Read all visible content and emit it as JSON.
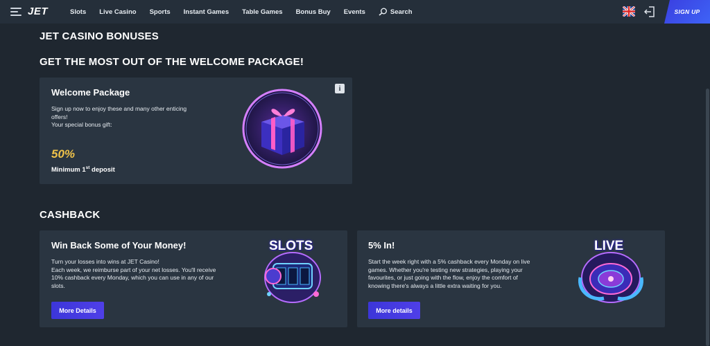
{
  "header": {
    "logo": "JET",
    "nav": [
      "Slots",
      "Live Casino",
      "Sports",
      "Instant Games",
      "Table Games",
      "Bonus Buy",
      "Events"
    ],
    "search_label": "Search",
    "signup_label": "SIGN UP",
    "language_flag": "uk-flag",
    "icons": [
      "hamburger-menu-icon",
      "search-icon",
      "login-icon"
    ]
  },
  "page": {
    "title": "JET CASINO BONUSES",
    "subtitle": "GET THE MOST OUT OF THE WELCOME PACKAGE!",
    "cashback_heading": "CASHBACK"
  },
  "welcome": {
    "title": "Welcome Package",
    "text_line1": "Sign up now to enjoy these and many other enticing",
    "text_line2": "offers!",
    "text_line3": "Your special bonus gift:",
    "percent": "50%",
    "deposit_prefix": "Minimum 1",
    "deposit_sup": "st",
    "deposit_suffix": " deposit",
    "info_label": "i"
  },
  "cashback": [
    {
      "title": "Win Back Some of Your Money!",
      "lines": [
        "Turn your losses into wins at JET Casino!",
        "Each week, we reimburse part of your net losses. You'll receive",
        "10% cashback every Monday, which you can use in any of our",
        "slots."
      ],
      "button": "More Details",
      "badge": "SLOTS"
    },
    {
      "title": "5% In!",
      "lines": [
        "Start the week right with a 5% cashback every Monday on live",
        "games. Whether you're testing new strategies, playing your",
        "favourites, or just going with the flow, enjoy the comfort of",
        "knowing there's always a little extra waiting for you."
      ],
      "button": "More details",
      "badge": "LIVE"
    }
  ],
  "colors": {
    "page_bg": "#1f2730",
    "header_bg": "#252f3a",
    "card_bg": "#2a3541",
    "accent_blue": "#3e3fe0",
    "percent_gold": "#f0c34a"
  }
}
